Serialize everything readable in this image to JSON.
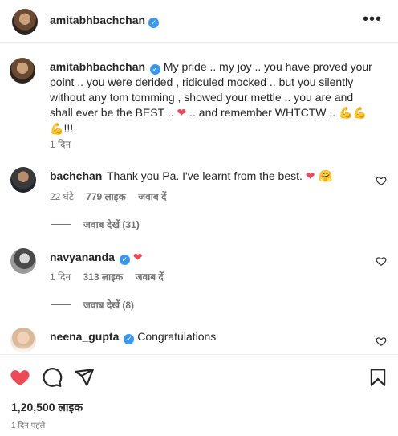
{
  "header": {
    "username": "amitabhbachchan",
    "more_icon": "more-horizontal-icon"
  },
  "caption": {
    "username": "amitabhbachchan",
    "text_1": "My pride .. my joy .. you have proved your point .. you were derided , ridiculed mocked .. but you silently without any tom tomming , showed your mettle .. you are and shall ever be the BEST ..",
    "heart": "❤",
    "text_2": ".. and remember WHTCTW ..",
    "flex": "💪💪",
    "flex2": "💪",
    "exclaim": "!!!",
    "time": "1 दिन"
  },
  "comments": [
    {
      "username": "bachchan",
      "verified": false,
      "text": "Thank you Pa. I've learnt from the best.",
      "emoji": "❤ 🤗",
      "time": "22 घंटे",
      "likes": "779 लाइक",
      "reply": "जवाब दें",
      "view_replies": "जवाब देखें (31)"
    },
    {
      "username": "navyananda",
      "verified": true,
      "text": "",
      "emoji": "❤",
      "time": "1 दिन",
      "likes": "313 लाइक",
      "reply": "जवाब दें",
      "view_replies": "जवाब देखें (8)"
    },
    {
      "username": "neena_gupta",
      "verified": true,
      "text": "Congratulations"
    }
  ],
  "actions": {
    "like_icon": "heart-filled-icon",
    "comment_icon": "comment-icon",
    "share_icon": "share-icon",
    "save_icon": "bookmark-icon",
    "like_color": "#ed4956",
    "likes": "1,20,500 लाइक",
    "posted": "1 दिन पहले"
  }
}
